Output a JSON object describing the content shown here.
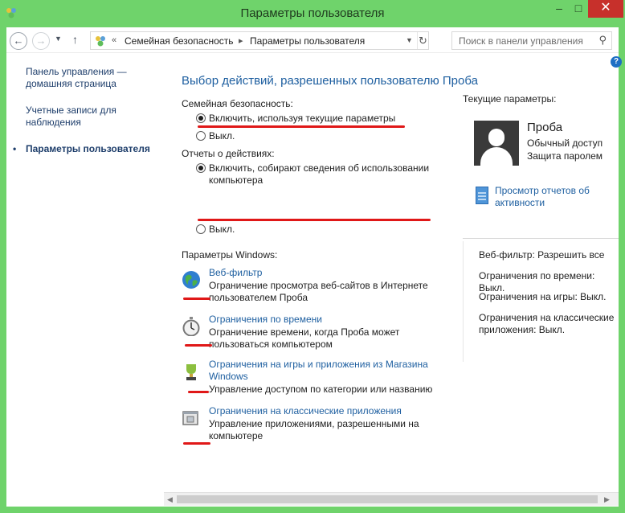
{
  "window": {
    "title": "Параметры пользователя"
  },
  "titlebar": {
    "min_icon": "minimize-icon",
    "max_icon": "maximize-icon",
    "close_icon": "close-icon"
  },
  "address": {
    "breadcrumb_sep": "«",
    "crumbs": [
      "Семейная безопасность",
      "Параметры пользователя"
    ],
    "search_placeholder": "Поиск в панели управления"
  },
  "leftnav": {
    "items": [
      {
        "label": "Панель управления — домашняя страница"
      },
      {
        "label": "Учетные записи для наблюдения"
      },
      {
        "label": "Параметры пользователя"
      }
    ],
    "bullet": "•"
  },
  "main": {
    "heading": "Выбор действий, разрешенных пользователю Проба",
    "family_safety": {
      "label": "Семейная безопасность:",
      "on_label": "Включить, используя текущие параметры",
      "off_label": "Выкл.",
      "selected": "on"
    },
    "activity_reports": {
      "label": "Отчеты о действиях:",
      "on_label": "Включить, собирают сведения об использовании компьютера",
      "off_label": "Выкл.",
      "selected": "on"
    },
    "windows_settings_label": "Параметры Windows:",
    "settings": [
      {
        "title": "Веб-фильтр",
        "desc": "Ограничение просмотра веб-сайтов в Интернете пользователем Проба",
        "icon": "globe-icon"
      },
      {
        "title": "Ограничения по времени",
        "desc": "Ограничение времени, когда Проба может пользоваться компьютером",
        "icon": "stopwatch-icon"
      },
      {
        "title": "Ограничения на игры и приложения из Магазина Windows",
        "desc": "Управление доступом по категории или названию",
        "icon": "trophy-icon"
      },
      {
        "title": "Ограничения на классические приложения",
        "desc": "Управление приложениями, разрешенными на компьютере",
        "icon": "app-window-icon"
      }
    ]
  },
  "rightpanel": {
    "label": "Текущие параметры:",
    "user": {
      "name": "Проба",
      "role": "Обычный доступ",
      "protection": "Защита паролем"
    },
    "reports_link": "Просмотр отчетов об активности",
    "items": [
      "Веб-фильтр: Разрешить все",
      "Ограничения по времени: Выкл.",
      "Ограничения на игры: Выкл.",
      "Ограничения на классические приложения: Выкл."
    ]
  },
  "colors": {
    "accent": "#1e5fa0",
    "frame": "#6fd36b",
    "annotation": "#e01818",
    "close": "#c7302b"
  }
}
